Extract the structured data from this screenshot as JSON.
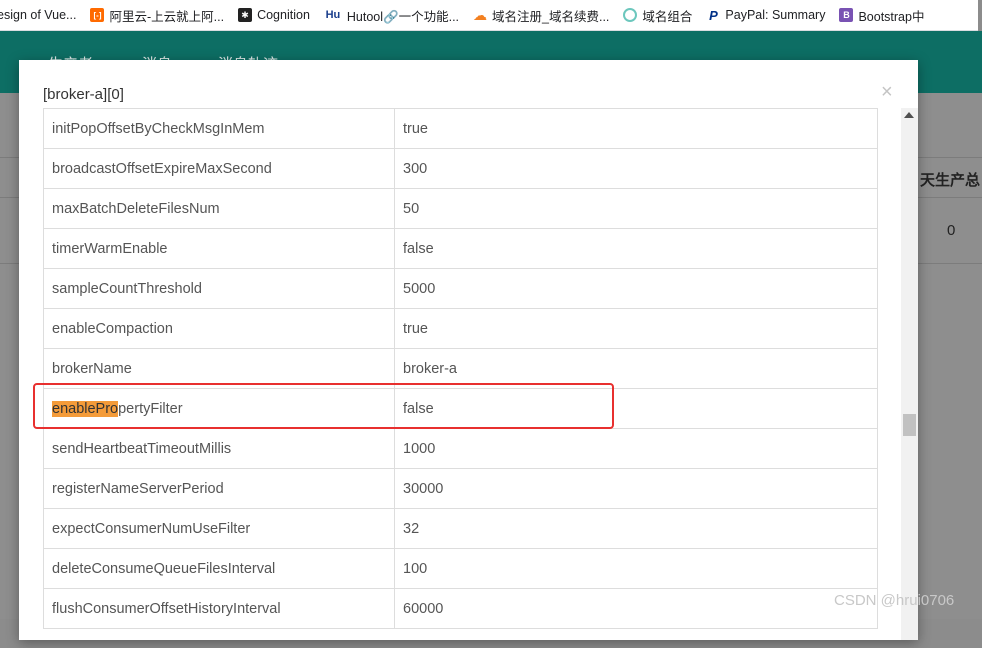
{
  "bookmarks": [
    {
      "label": "Design of Vue...",
      "icon": "ant-design-icon",
      "color": "#1677ff",
      "glyph": "A"
    },
    {
      "label": "阿里云-上云就上阿...",
      "icon": "aliyun-icon",
      "color": "#ff6a00",
      "glyph": "[-]"
    },
    {
      "label": "Cognition",
      "icon": "cognition-icon",
      "color": "#222222",
      "glyph": "✱"
    },
    {
      "label": "Hutool🔗一个功能...",
      "icon": "hutool-icon",
      "color": "#1a3e8c",
      "glyph": "Hu"
    },
    {
      "label": "域名注册_域名续费...",
      "icon": "cloudflare-icon",
      "color": "#f38020",
      "glyph": "☁"
    },
    {
      "label": "域名组合",
      "icon": "domain-combo-icon",
      "color": "#6cc7bd",
      "glyph": "◯"
    },
    {
      "label": "PayPal: Summary",
      "icon": "paypal-icon",
      "color": "#003087",
      "glyph": "P"
    },
    {
      "label": "Bootstrap中",
      "icon": "bootstrap-icon",
      "color": "#7952b3",
      "glyph": "B"
    }
  ],
  "nav": {
    "items": [
      "生产者",
      "消息",
      "消息轨迹"
    ]
  },
  "background": {
    "column_header": "天生产总",
    "cell_value": "0"
  },
  "modal": {
    "title": "[broker-a][0]",
    "close_glyph": "×",
    "rows": [
      {
        "key": "initPopOffsetByCheckMsgInMem",
        "value": "true"
      },
      {
        "key": "broadcastOffsetExpireMaxSecond",
        "value": "300"
      },
      {
        "key": "maxBatchDeleteFilesNum",
        "value": "50"
      },
      {
        "key": "timerWarmEnable",
        "value": "false"
      },
      {
        "key": "sampleCountThreshold",
        "value": "5000"
      },
      {
        "key": "enableCompaction",
        "value": "true"
      },
      {
        "key": "brokerName",
        "value": "broker-a"
      },
      {
        "key": "enablePropertyFilter",
        "value": "false",
        "highlight_prefix": "enablePro",
        "highlight_rest": "pertyFilter"
      },
      {
        "key": "sendHeartbeatTimeoutMillis",
        "value": "1000"
      },
      {
        "key": "registerNameServerPeriod",
        "value": "30000"
      },
      {
        "key": "expectConsumerNumUseFilter",
        "value": "32"
      },
      {
        "key": "deleteConsumeQueueFilesInterval",
        "value": "100"
      },
      {
        "key": "flushConsumerOffsetHistoryInterval",
        "value": "60000"
      }
    ]
  },
  "colors": {
    "search_highlight": "#f49b39",
    "annotation_border": "#e8302f",
    "nav_background": "#0d6e64"
  },
  "watermark": "CSDN @hrui0706"
}
